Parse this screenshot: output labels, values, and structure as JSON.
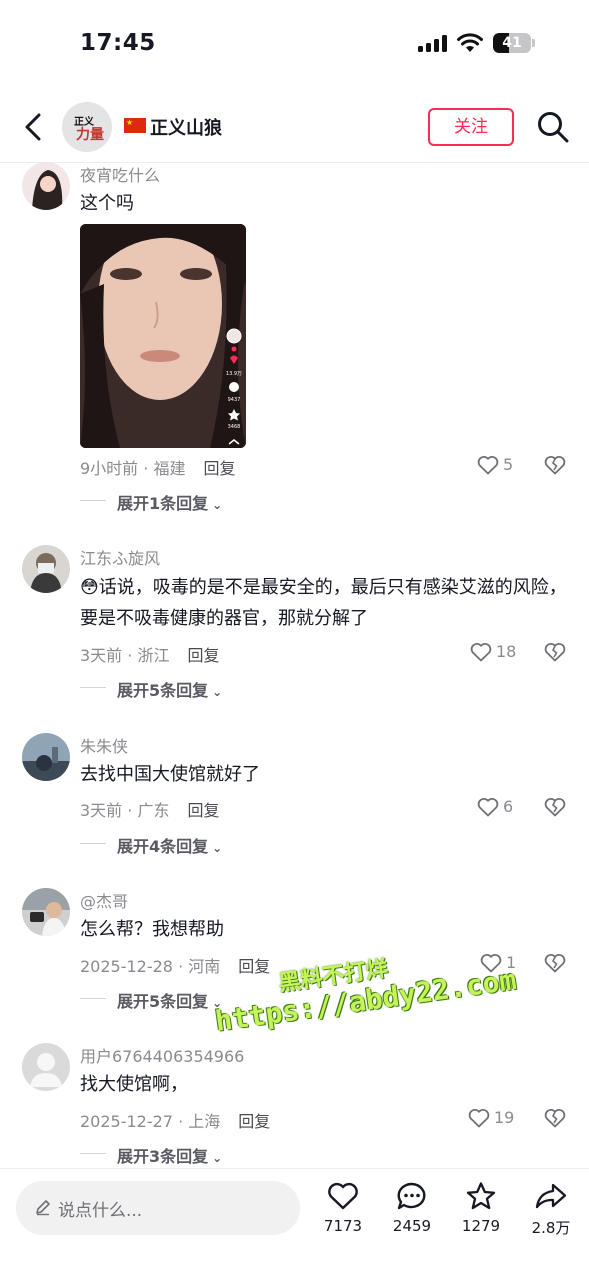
{
  "status_bar": {
    "time": "17:45",
    "battery": "41",
    "battery_level": 0.41
  },
  "header": {
    "channel_name": "正义山狼",
    "follow_label": "关注",
    "back_icon": "back-chevron-icon",
    "search_icon": "search-icon",
    "flag_icon": "china-flag-icon"
  },
  "comments": [
    {
      "user": "夜宵吃什么",
      "text": "这个吗",
      "meta": "9小时前 · 福建",
      "reply": "回复",
      "likes": "5",
      "expand": "展开1条回复",
      "has_video": true
    },
    {
      "user": "江东ふ旋风",
      "text": "话说，吸毒的是不是最安全的，最后只有感染艾滋的风险，要是不吸毒健康的器官，那就分解了",
      "emoji": "😳",
      "meta": "3天前 · 浙江",
      "reply": "回复",
      "likes": "18",
      "expand": "展开5条回复"
    },
    {
      "user": "朱朱侠",
      "text": "去找中国大使馆就好了",
      "meta": "3天前 · 广东",
      "reply": "回复",
      "likes": "6",
      "expand": "展开4条回复"
    },
    {
      "user": "@杰哥",
      "text": "怎么帮？我想帮助",
      "meta": "2025-12-28 · 河南",
      "reply": "回复",
      "likes": "1",
      "expand": "展开5条回复"
    },
    {
      "user": "用户6764406354966",
      "text": "找大使馆啊，",
      "meta": "2025-12-27 · 上海",
      "reply": "回复",
      "likes": "19",
      "expand": "展开3条回复"
    }
  ],
  "video_thumb": {
    "likes": "13.9万",
    "comments": "9437",
    "favorites": "3468"
  },
  "watermark": {
    "line1": "黑料不打烊",
    "line2": "https://abdy22.com"
  },
  "bottom_bar": {
    "placeholder": "说点什么...",
    "likes": "7173",
    "comments": "2459",
    "favorites": "1279",
    "shares": "2.8万"
  },
  "colors": {
    "accent": "#fe2c55",
    "text": "#161823",
    "muted": "#8a8b91"
  }
}
